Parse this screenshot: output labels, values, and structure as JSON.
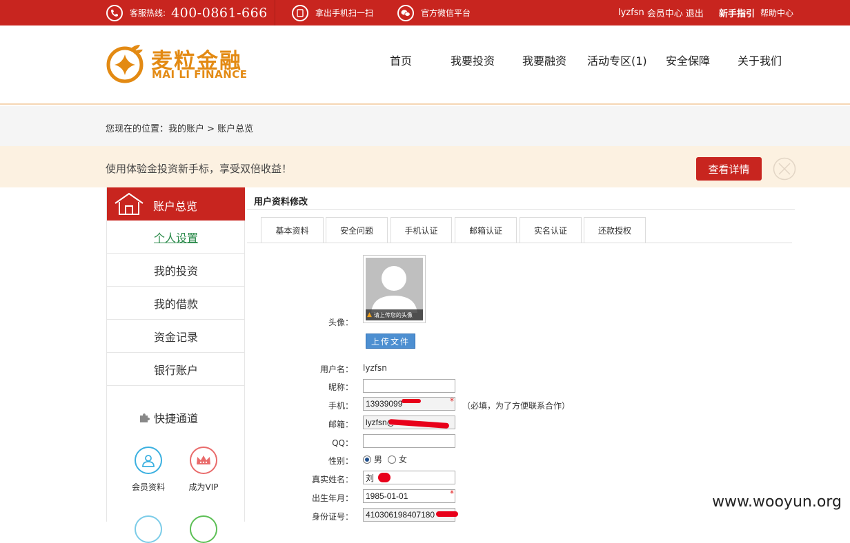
{
  "topbar": {
    "hotline_label": "客服热线:",
    "hotline_number": "400-0861-666",
    "scan_label": "拿出手机扫一扫",
    "wechat_label": "官方微信平台",
    "username": "lyzfsn",
    "member_center": "会员中心",
    "logout": "退出",
    "guide": "新手指引",
    "help": "帮助中心"
  },
  "header": {
    "logo_cn": "麦粒金融",
    "logo_en": "MAI LI FINANCE",
    "nav": [
      "首页",
      "我要投资",
      "我要融资",
      "活动专区(1)",
      "安全保障",
      "关于我们"
    ]
  },
  "breadcrumb": "您现在的位置：我的账户 > 账户总览",
  "promo": {
    "text": "使用体验金投资新手标，享受双倍收益！",
    "button": "查看详情"
  },
  "sidebar": {
    "header": "账户总览",
    "items": [
      "个人设置",
      "我的投资",
      "我的借款",
      "资金记录",
      "银行账户"
    ],
    "quick_title": "快捷通道",
    "quick_items": [
      "会员资料",
      "成为VIP"
    ]
  },
  "main": {
    "title": "用户资料修改",
    "tabs": [
      "基本资料",
      "安全问题",
      "手机认证",
      "邮箱认证",
      "实名认证",
      "还款授权"
    ],
    "avatar_label": "头像：",
    "avatar_hint": "请上传您的头像",
    "upload_button": "上传文件",
    "fields": {
      "username_label": "用户名：",
      "username_value": "lyzfsn",
      "nickname_label": "昵称：",
      "nickname_value": "",
      "phone_label": "手机：",
      "phone_value": "13939099",
      "phone_note": "（必填，为了方便联系合作）",
      "email_label": "邮箱：",
      "email_value": "lyzfsn@",
      "qq_label": "QQ：",
      "qq_value": "",
      "gender_label": "性别：",
      "gender_male": "男",
      "gender_female": "女",
      "realname_label": "真实姓名：",
      "realname_value": "刘",
      "birth_label": "出生年月：",
      "birth_value": "1985-01-01",
      "id_label": "身份证号：",
      "id_value": "410306198407180"
    },
    "required_mark": "*"
  },
  "watermark": "www.wooyun.org",
  "colors": {
    "brand_red": "#c8251f",
    "logo_orange": "#e38a13"
  }
}
